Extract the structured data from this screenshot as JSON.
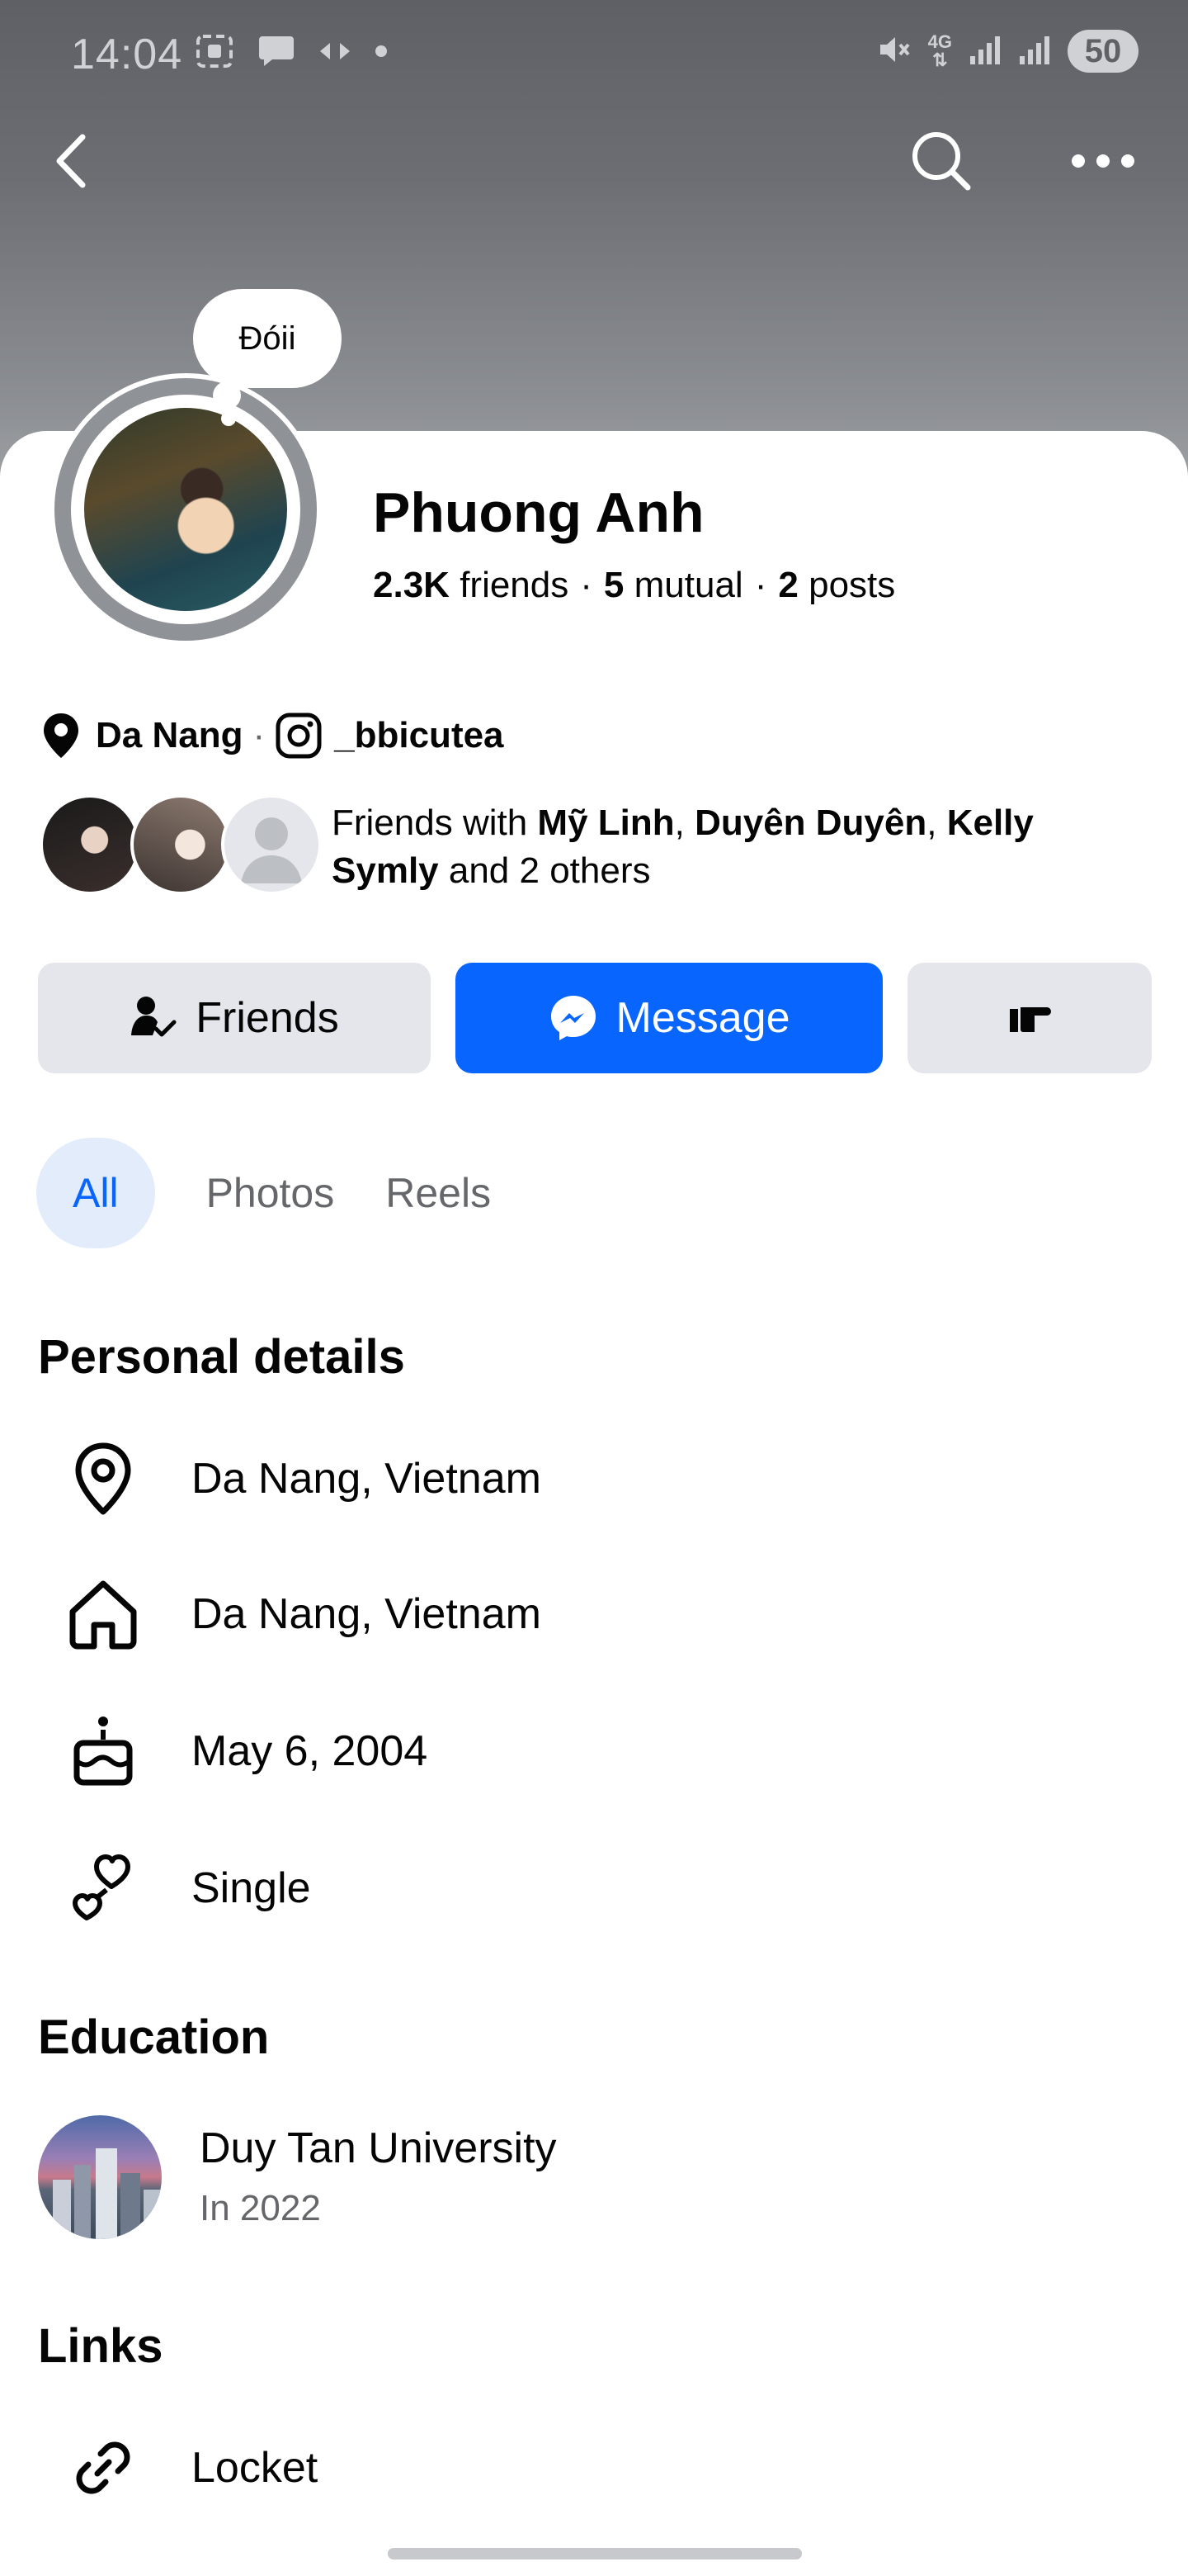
{
  "status_bar": {
    "time": "14:04",
    "battery": "50",
    "network": "4G"
  },
  "profile": {
    "status_note": "Đóii",
    "name": "Phuong Anh",
    "friends_count": "2.3K",
    "friends_label": "friends",
    "mutual_count": "5",
    "mutual_label": "mutual",
    "posts_count": "2",
    "posts_label": "posts",
    "location": "Da Nang",
    "instagram": "_bbicutea",
    "mutual": {
      "prefix": "Friends with ",
      "name1": "Mỹ Linh",
      "sep1": ", ",
      "name2": "Duyên Duyên",
      "sep2": ", ",
      "name3": "Kelly Symly",
      "suffix": " and 2 others"
    }
  },
  "actions": {
    "friends": "Friends",
    "message": "Message"
  },
  "tabs": [
    {
      "label": "All",
      "active": true
    },
    {
      "label": "Photos",
      "active": false
    },
    {
      "label": "Reels",
      "active": false
    }
  ],
  "personal_details": {
    "title": "Personal details",
    "items": [
      {
        "icon": "location-pin-icon",
        "text": "Da Nang, Vietnam"
      },
      {
        "icon": "home-icon",
        "text": "Da Nang, Vietnam"
      },
      {
        "icon": "birthday-cake-icon",
        "text": "May 6, 2004"
      },
      {
        "icon": "relationship-hearts-icon",
        "text": "Single"
      }
    ]
  },
  "education": {
    "title": "Education",
    "school": "Duy Tan University",
    "year": "In 2022"
  },
  "links": {
    "title": "Links",
    "items": [
      {
        "icon": "link-icon",
        "text": "Locket"
      }
    ]
  },
  "colors": {
    "accent": "#0866ff",
    "secondary_button": "#e4e6eb",
    "tab_active_bg": "#e2ecfb",
    "muted_text": "#65676b"
  }
}
